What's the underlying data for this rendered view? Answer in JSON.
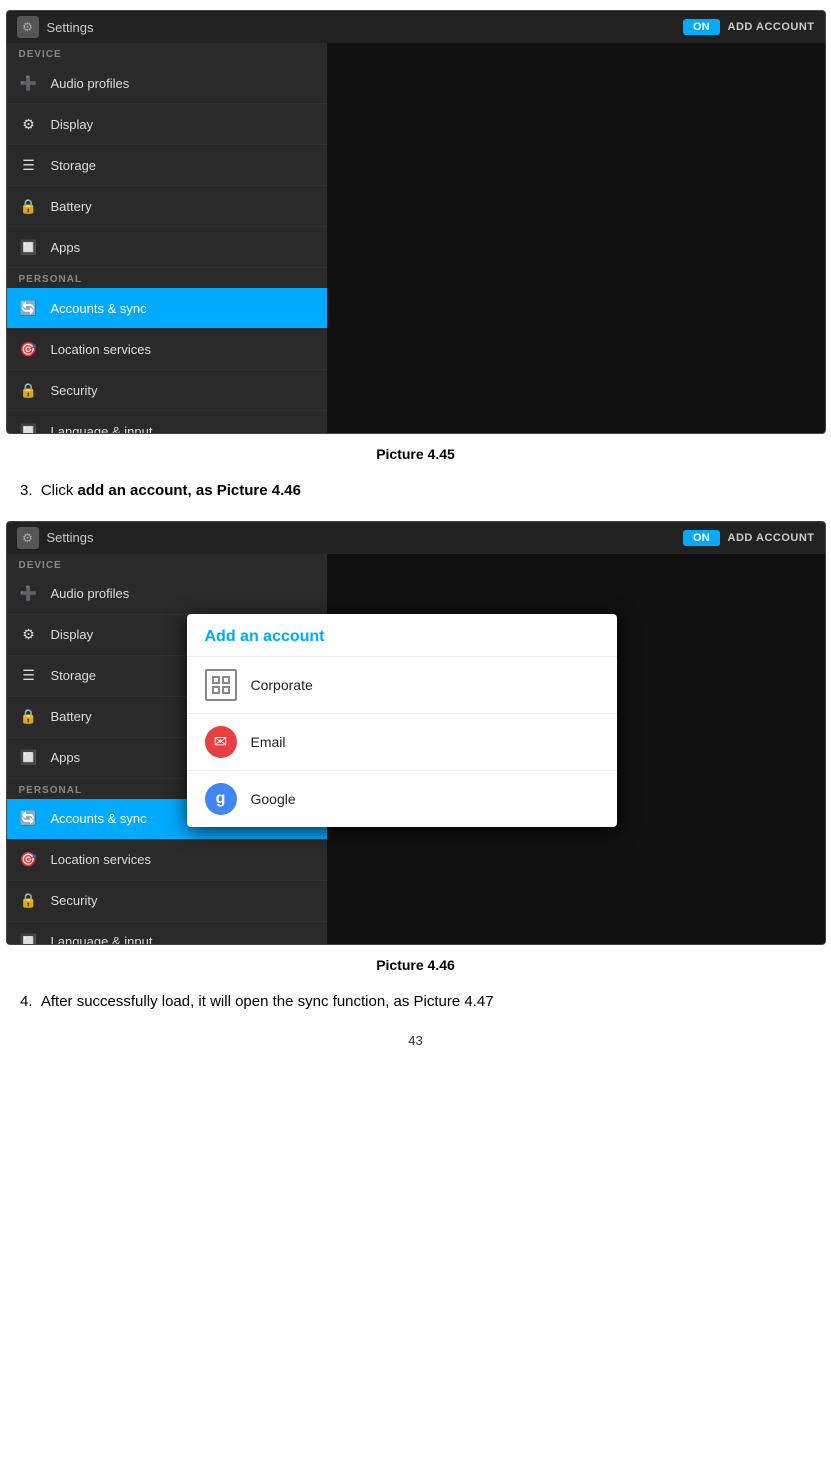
{
  "screen1": {
    "header": {
      "title": "Settings",
      "on_label": "ON",
      "add_account_label": "ADD ACCOUNT"
    },
    "sidebar": {
      "device_label": "DEVICE",
      "personal_label": "PERSONAL",
      "items": [
        {
          "label": "Audio profiles",
          "icon": "➕"
        },
        {
          "label": "Display",
          "icon": "⚙"
        },
        {
          "label": "Storage",
          "icon": "☰"
        },
        {
          "label": "Battery",
          "icon": "🔒"
        },
        {
          "label": "Apps",
          "icon": "🔲"
        },
        {
          "label": "Accounts & sync",
          "icon": "🔄",
          "active": true
        },
        {
          "label": "Location services",
          "icon": "🎯"
        },
        {
          "label": "Security",
          "icon": "🔒"
        },
        {
          "label": "Language & input",
          "icon": "🔲"
        }
      ]
    },
    "caption": "Picture 4.45"
  },
  "instruction1": {
    "number": "3.",
    "text": "Click add an account, as Picture 4.46"
  },
  "screen2": {
    "header": {
      "title": "Settings",
      "on_label": "ON",
      "add_account_label": "ADD ACCOUNT"
    },
    "dialog": {
      "title": "Add an account",
      "items": [
        {
          "label": "Corporate",
          "icon_type": "corporate"
        },
        {
          "label": "Email",
          "icon_type": "email"
        },
        {
          "label": "Google",
          "icon_type": "google"
        }
      ]
    },
    "caption": "Picture 4.46"
  },
  "instruction2": {
    "number": "4.",
    "text": "After successfully load, it will open the sync function, as Picture 4.47"
  },
  "page_number": "43"
}
